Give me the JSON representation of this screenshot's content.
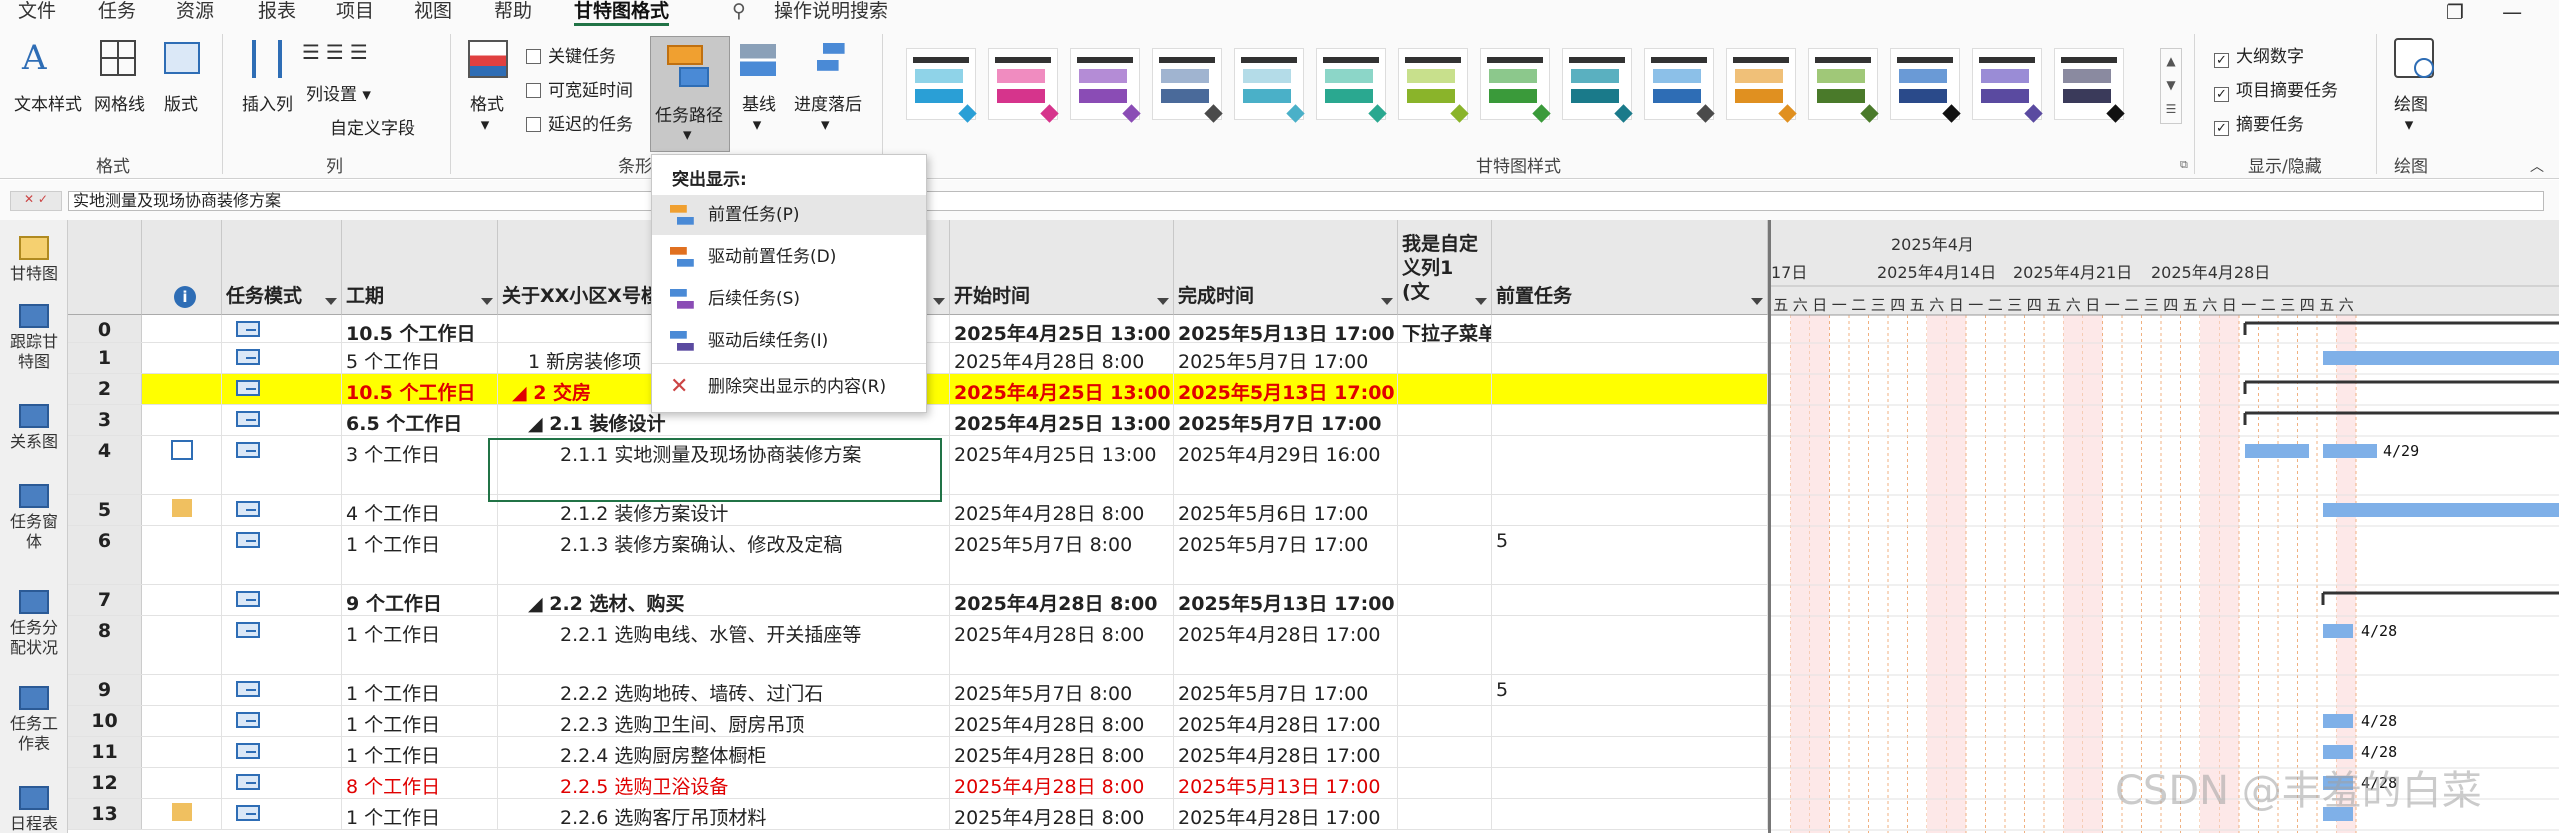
{
  "menu": {
    "items": [
      "文件",
      "任务",
      "资源",
      "报表",
      "项目",
      "视图",
      "帮助",
      "甘特图格式"
    ],
    "search": "操作说明搜索"
  },
  "ribbon": {
    "text_style": "文本样式",
    "gridlines": "网格线",
    "layout": "版式",
    "insert_column": "插入列",
    "column_settings": "列设置",
    "custom_fields": "自定义字段",
    "format": "格式",
    "critical_tasks": "关键任务",
    "slack": "可宽延时间",
    "late_tasks": "延迟的任务",
    "task_path": "任务路径",
    "baseline": "基线",
    "slippage": "进度落后",
    "outline_number": "大纲数字",
    "project_summary": "项目摘要任务",
    "summary_tasks": "摘要任务",
    "drawing": "绘图",
    "groups": {
      "format": "格式",
      "columns": "列",
      "bar_styles": "条形",
      "gantt_styles": "甘特图样式",
      "show_hide": "显示/隐藏",
      "drawings": "绘图"
    },
    "style_colors": [
      [
        "#8fd3e8",
        "#2a9fd6",
        "#2a9fd6"
      ],
      [
        "#f08cc0",
        "#d6348c",
        "#d6348c"
      ],
      [
        "#b48cd6",
        "#8a4cb5",
        "#8a4cb5"
      ],
      [
        "#a0b4d0",
        "#4a6a9a",
        "#4a4a4a"
      ],
      [
        "#b4dce8",
        "#4ab0c8",
        "#4ab0c8"
      ],
      [
        "#8cd6c8",
        "#2aa890",
        "#2aa890"
      ],
      [
        "#c8e08c",
        "#8ab42a",
        "#8ab42a"
      ],
      [
        "#8cc88c",
        "#3a9a3a",
        "#3a9a3a"
      ],
      [
        "#5ab0c0",
        "#1a7a8a",
        "#1a7a8a"
      ],
      [
        "#8cc0e8",
        "#2e6db5",
        "#4a4a4a"
      ],
      [
        "#f0c078",
        "#e09020",
        "#e09020"
      ],
      [
        "#a0c878",
        "#4a7a2a",
        "#4a7a2a"
      ],
      [
        "#6a9ad6",
        "#2a4a8a",
        "#111111"
      ],
      [
        "#9a8cd6",
        "#5a4aa0",
        "#5a4aa0"
      ],
      [
        "#8a8aa0",
        "#3a3a5a",
        "#111111"
      ]
    ]
  },
  "formula_bar": {
    "value": "实地测量及现场协商装修方案"
  },
  "sidebar": {
    "items": [
      "甘特图",
      "跟踪甘特图",
      "关系图",
      "任务窗体",
      "任务分配状况",
      "任务工作表",
      "日程表"
    ]
  },
  "columns": {
    "mode": "任务模式",
    "duration": "工期",
    "name": "关于XX小区X号楼",
    "start": "开始时间",
    "finish": "完成时间",
    "custom": "我是自定义列1 (文",
    "pred": "前置任务"
  },
  "rows": [
    {
      "id": "0",
      "dur": "10.5 个工作日",
      "name": "",
      "start": "2025年4月25日 13:00",
      "finish": "2025年5月13日 17:00",
      "custom": "下拉子菜单",
      "pred": "",
      "bold": true,
      "red": false
    },
    {
      "id": "1",
      "dur": "5 个工作日",
      "name": "1 新房装修项",
      "start": "2025年4月28日 8:00",
      "finish": "2025年5月7日 17:00",
      "custom": "",
      "pred": "",
      "bold": false,
      "red": false
    },
    {
      "id": "2",
      "dur": "10.5 个工作日",
      "name": "◢ 2 交房",
      "start": "2025年4月25日 13:00",
      "finish": "2025年5月13日 17:00",
      "custom": "",
      "pred": "",
      "bold": true,
      "red": true
    },
    {
      "id": "3",
      "dur": "6.5 个工作日",
      "name": "◢ 2.1 装修设计",
      "start": "2025年4月25日 13:00",
      "finish": "2025年5月7日 17:00",
      "custom": "",
      "pred": "",
      "bold": true,
      "red": false
    },
    {
      "id": "4",
      "dur": "3 个工作日",
      "name": "2.1.1 实地测量及现场协商装修方案",
      "start": "2025年4月25日 13:00",
      "finish": "2025年4月29日 16:00",
      "custom": "",
      "pred": "",
      "bold": false,
      "red": false
    },
    {
      "id": "5",
      "dur": "4 个工作日",
      "name": "2.1.2 装修方案设计",
      "start": "2025年4月28日 8:00",
      "finish": "2025年5月6日 17:00",
      "custom": "",
      "pred": "",
      "bold": false,
      "red": false
    },
    {
      "id": "6",
      "dur": "1 个工作日",
      "name": "2.1.3 装修方案确认、修改及定稿",
      "start": "2025年5月7日 8:00",
      "finish": "2025年5月7日 17:00",
      "custom": "",
      "pred": "5",
      "bold": false,
      "red": false
    },
    {
      "id": "7",
      "dur": "9 个工作日",
      "name": "◢ 2.2 选材、购买",
      "start": "2025年4月28日 8:00",
      "finish": "2025年5月13日 17:00",
      "custom": "",
      "pred": "",
      "bold": true,
      "red": false
    },
    {
      "id": "8",
      "dur": "1 个工作日",
      "name": "2.2.1 选购电线、水管、开关插座等",
      "start": "2025年4月28日 8:00",
      "finish": "2025年4月28日 17:00",
      "custom": "",
      "pred": "",
      "bold": false,
      "red": false
    },
    {
      "id": "9",
      "dur": "1 个工作日",
      "name": "2.2.2 选购地砖、墙砖、过门石",
      "start": "2025年5月7日 8:00",
      "finish": "2025年5月7日 17:00",
      "custom": "",
      "pred": "5",
      "bold": false,
      "red": false
    },
    {
      "id": "10",
      "dur": "1 个工作日",
      "name": "2.2.3 选购卫生间、厨房吊顶",
      "start": "2025年4月28日 8:00",
      "finish": "2025年4月28日 17:00",
      "custom": "",
      "pred": "",
      "bold": false,
      "red": false
    },
    {
      "id": "11",
      "dur": "1 个工作日",
      "name": "2.2.4 选购厨房整体橱柜",
      "start": "2025年4月28日 8:00",
      "finish": "2025年4月28日 17:00",
      "custom": "",
      "pred": "",
      "bold": false,
      "red": false
    },
    {
      "id": "12",
      "dur": "8 个工作日",
      "name": "2.2.5 选购卫浴设备",
      "start": "2025年4月28日 8:00",
      "finish": "2025年5月13日 17:00",
      "custom": "",
      "pred": "",
      "bold": false,
      "red": true
    },
    {
      "id": "13",
      "dur": "1 个工作日",
      "name": "2.2.6 选购客厅吊顶材料",
      "start": "2025年4月28日 8:00",
      "finish": "2025年4月28日 17:00",
      "custom": "",
      "pred": "",
      "bold": false,
      "red": false
    }
  ],
  "timescale": {
    "month": "2025年4月",
    "weeks": [
      "17日",
      "2025年4月14日",
      "2025年4月21日",
      "2025年4月28日"
    ],
    "days": [
      "五",
      "六",
      "日",
      "一",
      "二",
      "三",
      "四",
      "五",
      "六",
      "日",
      "一",
      "二",
      "三",
      "四",
      "五",
      "六",
      "日",
      "一",
      "二",
      "三",
      "四",
      "五",
      "六",
      "日",
      "一",
      "二",
      "三",
      "四",
      "五",
      "六"
    ]
  },
  "bar_labels": [
    "4/29",
    "4/28",
    "4/28",
    "4/28",
    "4/28"
  ],
  "dropdown": {
    "title": "突出显示:",
    "items": [
      "前置任务(P)",
      "驱动前置任务(D)",
      "后续任务(S)",
      "驱动后续任务(I)",
      "删除突出显示的内容(R)"
    ]
  },
  "watermark": "CSDN @丰羞的白菜"
}
